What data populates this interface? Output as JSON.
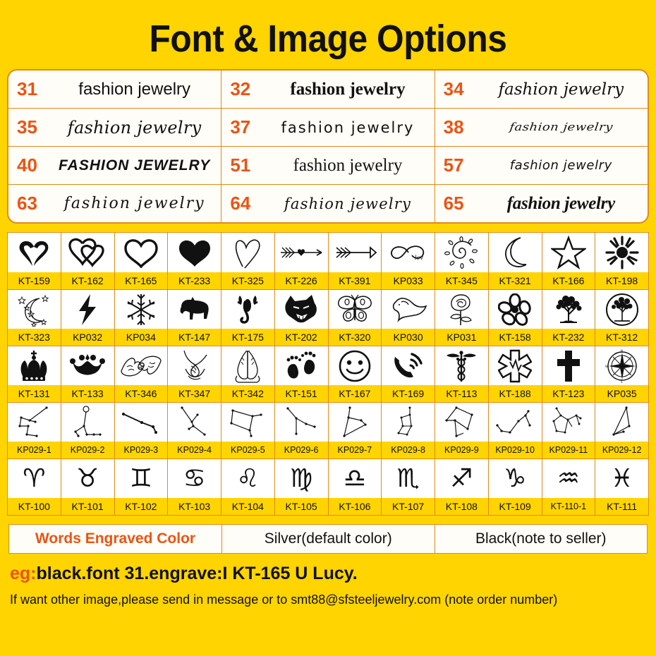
{
  "header": {
    "title": "Font & Image Options"
  },
  "colors": {
    "background": "#FFD400",
    "accent_orange": "#EA5414",
    "border": "#E08A1E",
    "cell_bg": "#FFFFFF"
  },
  "font_options": {
    "sample_text": "fashion jewelry",
    "rows": [
      [
        {
          "number": "31",
          "sample": "fashion jewelry",
          "style": "s31"
        },
        {
          "number": "32",
          "sample": "fashion jewelry",
          "style": "s32"
        },
        {
          "number": "34",
          "sample": "fashion jewelry",
          "style": "s34"
        }
      ],
      [
        {
          "number": "35",
          "sample": "fashion jewelry",
          "style": "s35"
        },
        {
          "number": "37",
          "sample": "fashion jewelry",
          "style": "s37"
        },
        {
          "number": "38",
          "sample": "fashion jewelry",
          "style": "s38"
        }
      ],
      [
        {
          "number": "40",
          "sample": "FASHION JEWELRY",
          "style": "s40"
        },
        {
          "number": "51",
          "sample": "fashion jewelry",
          "style": "s51"
        },
        {
          "number": "57",
          "sample": "fashion jewelry",
          "style": "s57"
        }
      ],
      [
        {
          "number": "63",
          "sample": "fashion jewelry",
          "style": "s63"
        },
        {
          "number": "64",
          "sample": "fashion jewelry",
          "style": "s64"
        },
        {
          "number": "65",
          "sample": "fashion jewelry",
          "style": "s65"
        }
      ]
    ]
  },
  "image_options": {
    "rows": [
      [
        {
          "code": "KT-159",
          "icon": "heart-swirl-icon"
        },
        {
          "code": "KT-162",
          "icon": "double-heart-icon"
        },
        {
          "code": "KT-165",
          "icon": "heart-outline-icon"
        },
        {
          "code": "KT-233",
          "icon": "heart-solid-icon"
        },
        {
          "code": "KT-325",
          "icon": "heart-sketch-icon"
        },
        {
          "code": "KT-226",
          "icon": "arrow-heart-icon"
        },
        {
          "code": "KT-391",
          "icon": "arrow-icon"
        },
        {
          "code": "KP033",
          "icon": "infinity-love-icon"
        },
        {
          "code": "KT-345",
          "icon": "sun-spiral-icon"
        },
        {
          "code": "KT-321",
          "icon": "crescent-moon-icon"
        },
        {
          "code": "KT-166",
          "icon": "star-outline-icon"
        },
        {
          "code": "KT-198",
          "icon": "sun-rays-icon"
        }
      ],
      [
        {
          "code": "KT-323",
          "icon": "moon-stars-icon"
        },
        {
          "code": "KP032",
          "icon": "lightning-bolt-icon"
        },
        {
          "code": "KP034",
          "icon": "snowflake-icon"
        },
        {
          "code": "KT-147",
          "icon": "dog-icon"
        },
        {
          "code": "KT-175",
          "icon": "scorpion-icon"
        },
        {
          "code": "KT-202",
          "icon": "wolf-head-icon"
        },
        {
          "code": "KT-320",
          "icon": "butterfly-icon"
        },
        {
          "code": "KP030",
          "icon": "dolphin-icon"
        },
        {
          "code": "KP031",
          "icon": "rose-icon"
        },
        {
          "code": "KT-158",
          "icon": "flower-icon"
        },
        {
          "code": "KT-232",
          "icon": "tree-icon"
        },
        {
          "code": "KT-312",
          "icon": "tree-of-life-circle-icon"
        }
      ],
      [
        {
          "code": "KT-131",
          "icon": "royal-crown-icon"
        },
        {
          "code": "KT-133",
          "icon": "tiara-crown-icon"
        },
        {
          "code": "KT-346",
          "icon": "pinky-promise-hands-icon"
        },
        {
          "code": "KT-347",
          "icon": "holding-hands-icon"
        },
        {
          "code": "KT-342",
          "icon": "praying-hands-icon"
        },
        {
          "code": "KT-151",
          "icon": "baby-feet-icon"
        },
        {
          "code": "KT-167",
          "icon": "smiley-face-icon"
        },
        {
          "code": "KT-169",
          "icon": "phone-call-icon"
        },
        {
          "code": "KT-113",
          "icon": "caduceus-icon"
        },
        {
          "code": "KT-188",
          "icon": "star-of-life-icon"
        },
        {
          "code": "KT-123",
          "icon": "cross-icon"
        },
        {
          "code": "KP035",
          "icon": "compass-rose-icon"
        }
      ],
      [
        {
          "code": "KP029-1",
          "icon": "constellation-1-icon"
        },
        {
          "code": "KP029-2",
          "icon": "constellation-2-icon"
        },
        {
          "code": "KP029-3",
          "icon": "constellation-3-icon"
        },
        {
          "code": "KP029-4",
          "icon": "constellation-4-icon"
        },
        {
          "code": "KP029-5",
          "icon": "constellation-5-icon"
        },
        {
          "code": "KP029-6",
          "icon": "constellation-6-icon"
        },
        {
          "code": "KP029-7",
          "icon": "constellation-7-icon"
        },
        {
          "code": "KP029-8",
          "icon": "constellation-8-icon"
        },
        {
          "code": "KP029-9",
          "icon": "constellation-9-icon"
        },
        {
          "code": "KP029-10",
          "icon": "constellation-10-icon"
        },
        {
          "code": "KP029-11",
          "icon": "constellation-11-icon"
        },
        {
          "code": "KP029-12",
          "icon": "constellation-12-icon"
        }
      ],
      [
        {
          "code": "KT-100",
          "icon": "aries-icon",
          "glyph": "♈"
        },
        {
          "code": "KT-101",
          "icon": "taurus-icon",
          "glyph": "♉"
        },
        {
          "code": "KT-102",
          "icon": "gemini-icon",
          "glyph": "♊"
        },
        {
          "code": "KT-103",
          "icon": "cancer-icon",
          "glyph": "♋"
        },
        {
          "code": "KT-104",
          "icon": "leo-icon",
          "glyph": "♌"
        },
        {
          "code": "KT-105",
          "icon": "virgo-icon",
          "glyph": "♍"
        },
        {
          "code": "KT-106",
          "icon": "libra-icon",
          "glyph": "♎"
        },
        {
          "code": "KT-107",
          "icon": "scorpio-icon",
          "glyph": "♏"
        },
        {
          "code": "KT-108",
          "icon": "sagittarius-icon",
          "glyph": "♐"
        },
        {
          "code": "KT-109",
          "icon": "capricorn-icon",
          "glyph": "♑"
        },
        {
          "code": "KT-110-1",
          "icon": "aquarius-icon",
          "glyph": "♒"
        },
        {
          "code": "KT-111",
          "icon": "pisces-icon",
          "glyph": "♓"
        }
      ]
    ]
  },
  "engraved_color": {
    "label": "Words Engraved Color",
    "options": [
      "Silver(default color)",
      "Black(note to seller)"
    ]
  },
  "footer": {
    "example_prefix": "eg:",
    "example_text": "black.font 31.engrave:I KT-165 U Lucy.",
    "note": "If want other image,please send in message or to smt88@sfsteeljewelry.com (note order number)"
  }
}
